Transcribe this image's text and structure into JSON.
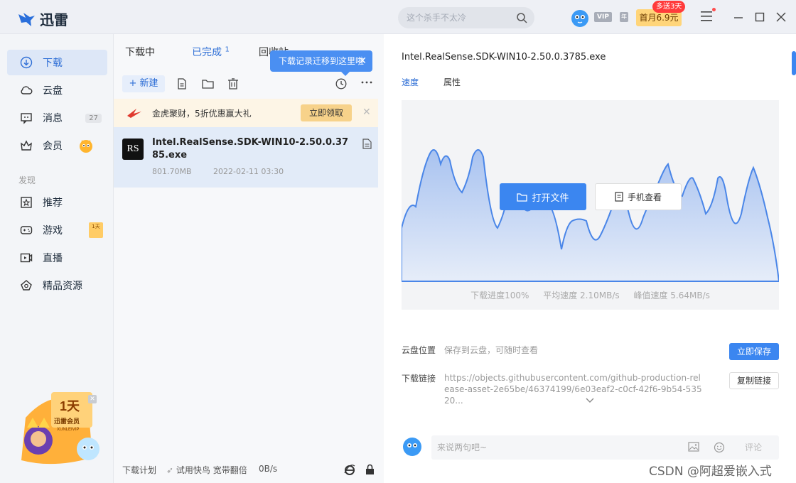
{
  "app": {
    "name": "迅雷"
  },
  "topbar": {
    "search_placeholder": "这个杀手不太冷",
    "vip_label": "VIP",
    "vip_year": "年",
    "promo_button": "首月6.9元",
    "promo_tag": "多送3天"
  },
  "sidebar": {
    "items": [
      {
        "label": "下载",
        "icon": "download-icon"
      },
      {
        "label": "云盘",
        "icon": "cloud-icon"
      },
      {
        "label": "消息",
        "icon": "message-icon",
        "count": "27"
      },
      {
        "label": "会员",
        "icon": "crown-icon"
      }
    ],
    "section": "发现",
    "discover": [
      {
        "label": "推荐",
        "icon": "star-icon"
      },
      {
        "label": "游戏",
        "icon": "gamepad-icon",
        "badge": "1天"
      },
      {
        "label": "直播",
        "icon": "live-icon"
      },
      {
        "label": "精品资源",
        "icon": "diamond-icon"
      }
    ],
    "mascot_text": "1天",
    "mascot_sub": "迅雷会员",
    "mascot_brand": "XUNLEIVIP"
  },
  "middle": {
    "tabs": [
      {
        "label": "下载中"
      },
      {
        "label": "已完成",
        "count": "1"
      },
      {
        "label": "回收站"
      }
    ],
    "tooltip": "下载记录迁移到这里啦",
    "new_button": "新建",
    "promo_text": "金虎聚财，5折优惠赢大礼",
    "promo_claim": "立即领取",
    "file": {
      "name": "Intel.RealSense.SDK-WIN10-2.50.0.3785.exe",
      "size": "801.70MB",
      "date": "2022-02-11 03:30",
      "icon_text": "RS"
    },
    "status": {
      "plan": "下载计划",
      "fast": "试用快鸟 宽带翻倍",
      "speed": "0B/s"
    }
  },
  "detail": {
    "title": "Intel.RealSense.SDK-WIN10-2.50.0.3785.exe",
    "tabs": [
      "速度",
      "属性"
    ],
    "open_button": "打开文件",
    "phone_button": "手机查看",
    "progress": "下载进度100%",
    "avg_speed": "平均速度 2.10MB/s",
    "peak_speed": "峰值速度 5.64MB/s",
    "cloud_label": "云盘位置",
    "cloud_desc": "保存到云盘，可随时查看",
    "save_button": "立即保存",
    "link_label": "下载链接",
    "link_url": "https://objects.githubusercontent.com/github-production-release-asset-2e65be/46374199/6e03eaf2-c0cf-42f6-9b54-53520...",
    "copy_button": "复制链接",
    "comment_placeholder": "来说两句吧~",
    "comment_send": "评论"
  },
  "watermark": "CSDN @阿超爱嵌入式",
  "colors": {
    "accent": "#3b86f0",
    "chart_fill": "#c9d8f3",
    "chart_line": "#4a86e8"
  }
}
